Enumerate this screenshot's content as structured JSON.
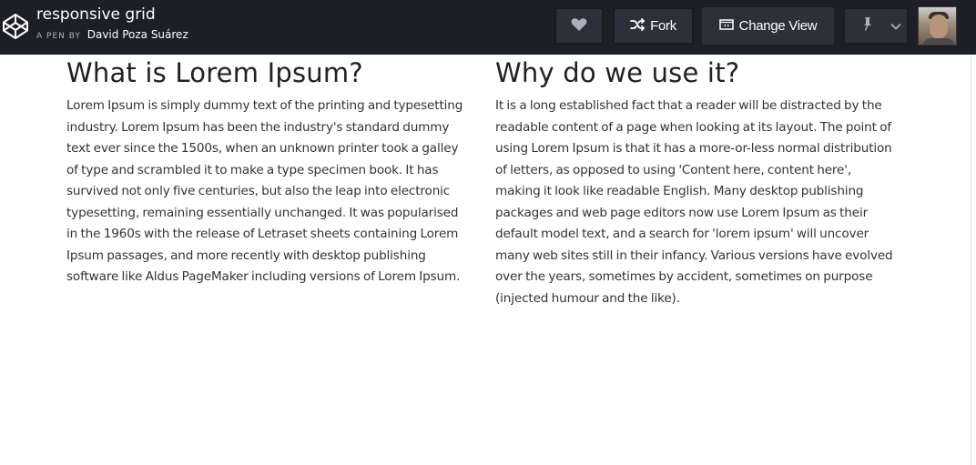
{
  "header": {
    "pen_title": "responsive grid",
    "by_prefix": "A PEN BY",
    "author": "David Poza Suárez",
    "buttons": {
      "fork_label": "Fork",
      "change_view_label": "Change View"
    },
    "icons": [
      "codepen-logo-icon",
      "heart-icon",
      "fork-icon",
      "change-view-icon",
      "pin-icon",
      "chevron-down-icon",
      "avatar"
    ]
  },
  "main": {
    "left": {
      "heading": "What is Lorem Ipsum?",
      "body": "Lorem Ipsum is simply dummy text of the printing and typesetting industry. Lorem Ipsum has been the industry's standard dummy text ever since the 1500s, when an unknown printer took a galley of type and scrambled it to make a type specimen book. It has survived not only five centuries, but also the leap into electronic typesetting, remaining essentially unchanged. It was popularised in the 1960s with the release of Letraset sheets containing Lorem Ipsum passages, and more recently with desktop publishing software like Aldus PageMaker including versions of Lorem Ipsum."
    },
    "right": {
      "heading": "Why do we use it?",
      "body": "It is a long established fact that a reader will be distracted by the readable content of a page when looking at its layout. The point of using Lorem Ipsum is that it has a more-or-less normal distribution of letters, as opposed to using 'Content here, content here', making it look like readable English. Many desktop publishing packages and web page editors now use Lorem Ipsum as their default model text, and a search for 'lorem ipsum' will uncover many web sites still in their infancy. Various versions have evolved over the years, sometimes by accident, sometimes on purpose (injected humour and the like)."
    }
  },
  "colors": {
    "topbar_bg": "#1e1f26",
    "button_bg": "#2c303a",
    "text": "#333333",
    "heading": "#222222"
  }
}
